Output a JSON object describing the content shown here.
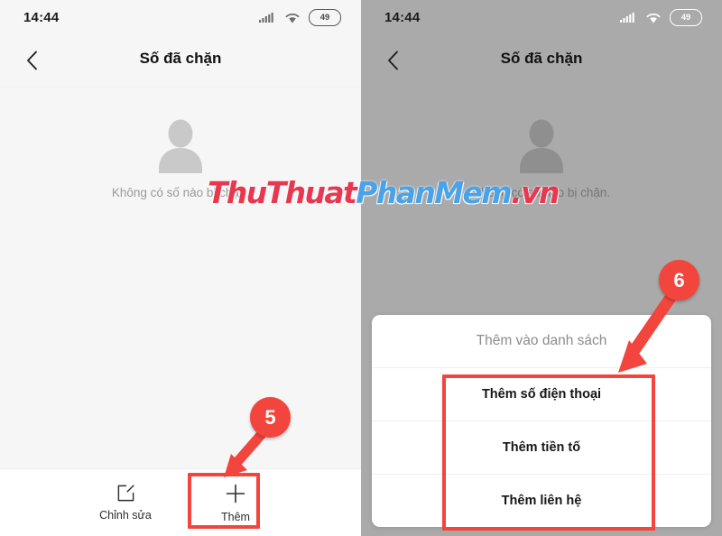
{
  "status_bar": {
    "time": "14:44",
    "battery_text": "49",
    "signal_icon": "signal-bars-icon",
    "wifi_icon": "wifi-icon",
    "battery_icon": "battery-icon"
  },
  "header": {
    "title": "Số đã chặn",
    "back_icon": "chevron-left-icon"
  },
  "empty_state": {
    "avatar_icon": "person-silhouette-icon",
    "message": "Không có số nào bị chặn."
  },
  "toolbar": {
    "edit_label": "Chỉnh sửa",
    "edit_icon": "edit-square-icon",
    "add_label": "Thêm",
    "add_icon": "plus-icon"
  },
  "dialog": {
    "title": "Thêm vào danh sách",
    "options": [
      {
        "label": "Thêm số điện thoại"
      },
      {
        "label": "Thêm tiền tố"
      },
      {
        "label": "Thêm liên hệ"
      }
    ]
  },
  "annotations": {
    "badge_5": "5",
    "badge_6": "6",
    "accent_color": "#f2453d",
    "arrow_5_icon": "arrow-down-left-icon",
    "arrow_6_icon": "arrow-down-left-icon"
  },
  "watermark": {
    "part1": "ThuThuat",
    "part2": "PhanMem",
    "part3": ".vn",
    "color1": "#e8384f",
    "color2": "#4aa3e8"
  }
}
